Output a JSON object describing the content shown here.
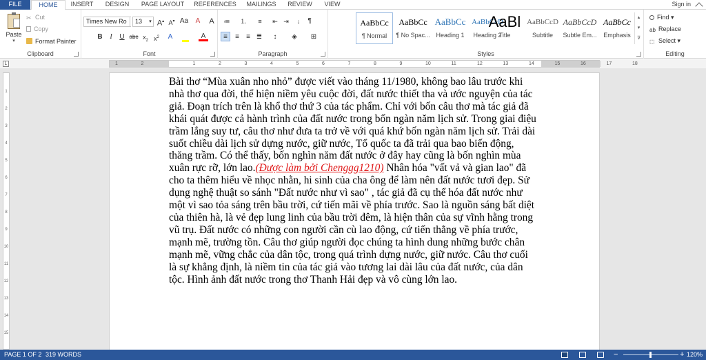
{
  "tabs": [
    "FILE",
    "HOME",
    "INSERT",
    "DESIGN",
    "PAGE LAYOUT",
    "REFERENCES",
    "MAILINGS",
    "REVIEW",
    "VIEW"
  ],
  "signin": "Sign in",
  "clipboard": {
    "paste": "Paste",
    "cut": "Cut",
    "copy": "Copy",
    "format_painter": "Format Painter",
    "label": "Clipboard"
  },
  "font": {
    "name": "Times New Ro",
    "size": "13",
    "label": "Font"
  },
  "paragraph": {
    "label": "Paragraph"
  },
  "styles": {
    "label": "Styles",
    "items": [
      {
        "preview": "AaBbCc",
        "name": "¶ Normal"
      },
      {
        "preview": "AaBbCc",
        "name": "¶ No Spac..."
      },
      {
        "preview": "AaBbCc",
        "name": "Heading 1"
      },
      {
        "preview": "AaBbCcD",
        "name": "Heading 2"
      },
      {
        "preview": "AaBl",
        "name": "Title"
      },
      {
        "preview": "AaBbCcD",
        "name": "Subtitle"
      },
      {
        "preview": "AaBbCcD",
        "name": "Subtle Em..."
      },
      {
        "preview": "AaBbCc",
        "name": "Emphasis"
      }
    ]
  },
  "editing": {
    "find": "Find",
    "replace": "Replace",
    "select": "Select",
    "label": "Editing"
  },
  "ruler_h": [
    "1",
    "2",
    "1",
    "2",
    "3",
    "4",
    "5",
    "6",
    "7",
    "8",
    "9",
    "10",
    "11",
    "12",
    "13",
    "14",
    "15",
    "16",
    "17",
    "18"
  ],
  "ruler_v": [
    "1",
    "2",
    "3",
    "4",
    "5",
    "6",
    "7",
    "8",
    "9",
    "10",
    "11",
    "12",
    "13",
    "14",
    "15"
  ],
  "document": {
    "part1": "Bài thơ “Mùa xuân nho nhỏ” được viết vào tháng 11/1980, không bao lâu trước khi\nnhà thơ qua đời, thể hiện niềm yêu cuộc đời, đất nước thiết tha và ước nguyện của tác\ngiả. Đoạn trích trên là  khổ thơ thứ 3 của tác phẩm. Chỉ với bốn câu thơ mà tác giả đã\nkhái quát được cả hành trình của đất nước trong bốn ngàn năm lịch sử. Trong giai điệu\ntrầm lắng suy tư, câu thơ như đưa ta trở về với quá khứ bốn ngàn năm lịch sử. Trải dài\nsuốt chiều dài lịch sử dựng nước, giữ nước, Tổ quốc ta đã trải qua bao biến động,\nthăng trầm. Có thể thấy, bốn nghìn năm đất nước ở đây hay cũng là bốn nghìn mùa\nxuân rực rỡ, lớn lao.",
    "red": "(Được làm bởi Chenggg1210)",
    "part2": " Nhân hóa \"vất vả và gian lao\" đã\ncho ta thêm hiểu về nhọc nhằn, hi sinh của cha ông để làm nên đất nước tươi đẹp. Sử\ndụng nghệ thuật so sánh \"Đất nước như vì sao\" , tác giả đã cụ thể hóa đất nước như\nmột vì sao tỏa sáng trên bầu trời, cứ tiến mãi về phía trước. Sao là nguồn sáng bất diệt\ncủa thiên hà, là vẻ đẹp lung linh của bầu trời đêm, là hiện thân của sự vĩnh hằng trong\nvũ trụ. Đất nước có những con người cần cù lao động, cứ tiến thẳng về phía trước,\nmạnh mẽ, trường tồn. Câu thơ giúp người đọc chúng ta hình dung những bước chân\nmạnh mẽ, vững chắc của dân tộc, trong quá trình dựng nước, giữ nước. Câu thơ cuối\nlà sự khẳng định, là niềm tin của tác giả vào tương lai dài lâu của đất nước, của dân\ntộc. Hình ảnh đất nước trong thơ Thanh Hải đẹp và vô cùng lớn lao."
  },
  "status": {
    "page": "PAGE 1 OF 2",
    "words": "319 WORDS",
    "zoom": "120%",
    "zoom_level": 0.5
  },
  "colors": {
    "accent": "#2b579a",
    "highlight": "#ffff00",
    "font_color": "#ff0000",
    "link_red": "#e01818"
  }
}
